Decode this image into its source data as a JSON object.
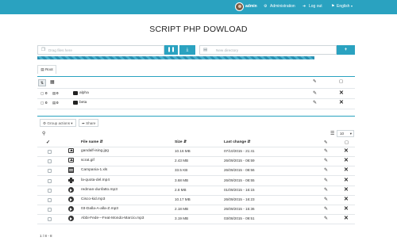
{
  "navbar": {
    "user_label": "admin",
    "admin_label": "Administration",
    "logout_label": "Log out",
    "lang_label": "English",
    "colors": {
      "bar": "#2aa2c0"
    }
  },
  "page_title": "SCRIPT PHP DOWLOAD",
  "upload": {
    "files_placeholder": "Drag files here",
    "dir_placeholder": "New directory",
    "add_label": "+"
  },
  "breadcrumb": {
    "root_label": "Root"
  },
  "directories": [
    {
      "name": "alpha",
      "files": "0",
      "subdirs": "0"
    },
    {
      "name": "beta",
      "files": "0",
      "subdirs": "0"
    }
  ],
  "toolbar": {
    "group_actions_label": "Group actions",
    "share_label": "Share",
    "per_page": "10"
  },
  "table": {
    "headers": {
      "name": "File name",
      "size": "Size",
      "date": "Last change"
    },
    "rows": [
      {
        "type": "image",
        "name": "gandalf-ising.jpg",
        "size": "10.16 MB",
        "date": "07/10/2015 - 21:41"
      },
      {
        "type": "image",
        "name": "scrat.gif",
        "size": "2.43 MB",
        "date": "26/09/2015 - 08:59"
      },
      {
        "type": "spreadsheet",
        "name": "Campania-1.xls",
        "size": "33.5 KB",
        "date": "26/09/2015 - 08:56"
      },
      {
        "type": "video",
        "name": "la-quota-del.mp4",
        "size": "3.68 MB",
        "date": "26/09/2015 - 08:55"
      },
      {
        "type": "audio",
        "name": "redman-dunfatto.mp3",
        "size": "2.8 MB",
        "date": "01/09/2015 - 16:15"
      },
      {
        "type": "audio",
        "name": "Cisco-kid.mp3",
        "size": "10.17 MB",
        "date": "26/09/2015 - 16:23"
      },
      {
        "type": "audio",
        "name": "03-Dalla-A-alla-Z.mp3",
        "size": "2.18 MB",
        "date": "26/09/2015 - 15:36"
      },
      {
        "type": "audio",
        "name": "Abbi-Fede---Feat-Mondo-Marcio.mp3",
        "size": "3.19 MB",
        "date": "03/08/2015 - 09:51"
      }
    ]
  },
  "footer": {
    "count_label": "1 / 8 - 8"
  }
}
